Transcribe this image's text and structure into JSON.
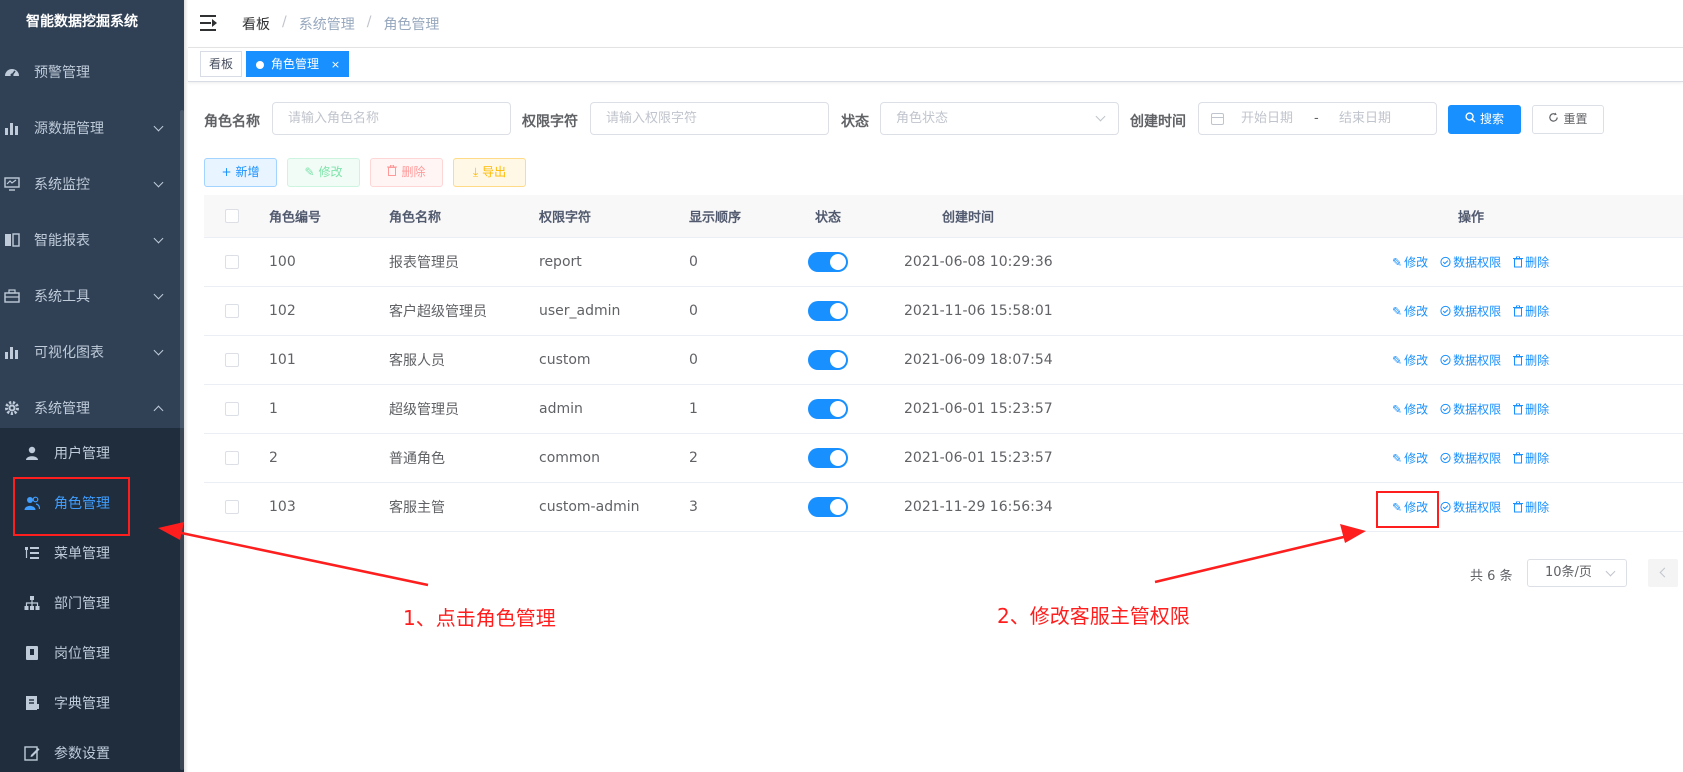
{
  "app": {
    "title": "智能数据挖掘系统"
  },
  "sidebar": {
    "items": [
      {
        "label": "预警管理",
        "icon": "dashboard-icon",
        "has_arrow": false
      },
      {
        "label": "源数据管理",
        "icon": "bar-chart-icon",
        "has_arrow": true
      },
      {
        "label": "系统监控",
        "icon": "monitor-icon",
        "has_arrow": true
      },
      {
        "label": "智能报表",
        "icon": "book-icon",
        "has_arrow": true
      },
      {
        "label": "系统工具",
        "icon": "toolbox-icon",
        "has_arrow": true
      },
      {
        "label": "可视化图表",
        "icon": "bar-chart-icon",
        "has_arrow": true
      },
      {
        "label": "系统管理",
        "icon": "gear-icon",
        "has_arrow": true,
        "expanded": true
      }
    ],
    "subitems": [
      {
        "label": "用户管理",
        "icon": "user-icon"
      },
      {
        "label": "角色管理",
        "icon": "peoples-icon",
        "active": true
      },
      {
        "label": "菜单管理",
        "icon": "tree-table-icon"
      },
      {
        "label": "部门管理",
        "icon": "tree-icon"
      },
      {
        "label": "岗位管理",
        "icon": "post-icon"
      },
      {
        "label": "字典管理",
        "icon": "dict-icon"
      },
      {
        "label": "参数设置",
        "icon": "edit-icon"
      }
    ]
  },
  "navbar": {
    "breadcrumb": [
      "看板",
      "系统管理",
      "角色管理"
    ]
  },
  "tags": [
    {
      "label": "看板",
      "active": false
    },
    {
      "label": "角色管理",
      "active": true,
      "close": "×"
    }
  ],
  "search": {
    "role_name_label": "角色名称",
    "role_name_placeholder": "请输入角色名称",
    "perm_label": "权限字符",
    "perm_placeholder": "请输入权限字符",
    "status_label": "状态",
    "status_placeholder": "角色状态",
    "created_label": "创建时间",
    "start_placeholder": "开始日期",
    "range_sep": "-",
    "end_placeholder": "结束日期",
    "search_btn": "搜索",
    "reset_btn": "重置"
  },
  "toolbar": {
    "add": "新增",
    "edit": "修改",
    "delete": "删除",
    "export": "导出"
  },
  "table": {
    "headers": {
      "id": "角色编号",
      "name": "角色名称",
      "perm": "权限字符",
      "order": "显示顺序",
      "status": "状态",
      "created": "创建时间",
      "ops": "操作"
    },
    "op_labels": {
      "edit": "修改",
      "data_perm": "数据权限",
      "delete": "删除"
    },
    "rows": [
      {
        "id": "100",
        "name": "报表管理员",
        "perm": "report",
        "order": "0",
        "status": true,
        "created": "2021-06-08 10:29:36"
      },
      {
        "id": "102",
        "name": "客户超级管理员",
        "perm": "user_admin",
        "order": "0",
        "status": true,
        "created": "2021-11-06 15:58:01"
      },
      {
        "id": "101",
        "name": "客服人员",
        "perm": "custom",
        "order": "0",
        "status": true,
        "created": "2021-06-09 18:07:54"
      },
      {
        "id": "1",
        "name": "超级管理员",
        "perm": "admin",
        "order": "1",
        "status": true,
        "created": "2021-06-01 15:23:57"
      },
      {
        "id": "2",
        "name": "普通角色",
        "perm": "common",
        "order": "2",
        "status": true,
        "created": "2021-06-01 15:23:57"
      },
      {
        "id": "103",
        "name": "客服主管",
        "perm": "custom-admin",
        "order": "3",
        "status": true,
        "created": "2021-11-29 16:56:34"
      }
    ]
  },
  "pagination": {
    "total": "共 6 条",
    "page_size": "10条/页"
  },
  "annotations": {
    "step1": "1、点击角色管理",
    "step2": "2、修改客服主管权限",
    "color": "#ff1e1e"
  },
  "colors": {
    "sidebar_bg": "#304156",
    "submenu_bg": "#1f2d3d",
    "primary": "#1890ff",
    "active_text": "#409eff"
  }
}
